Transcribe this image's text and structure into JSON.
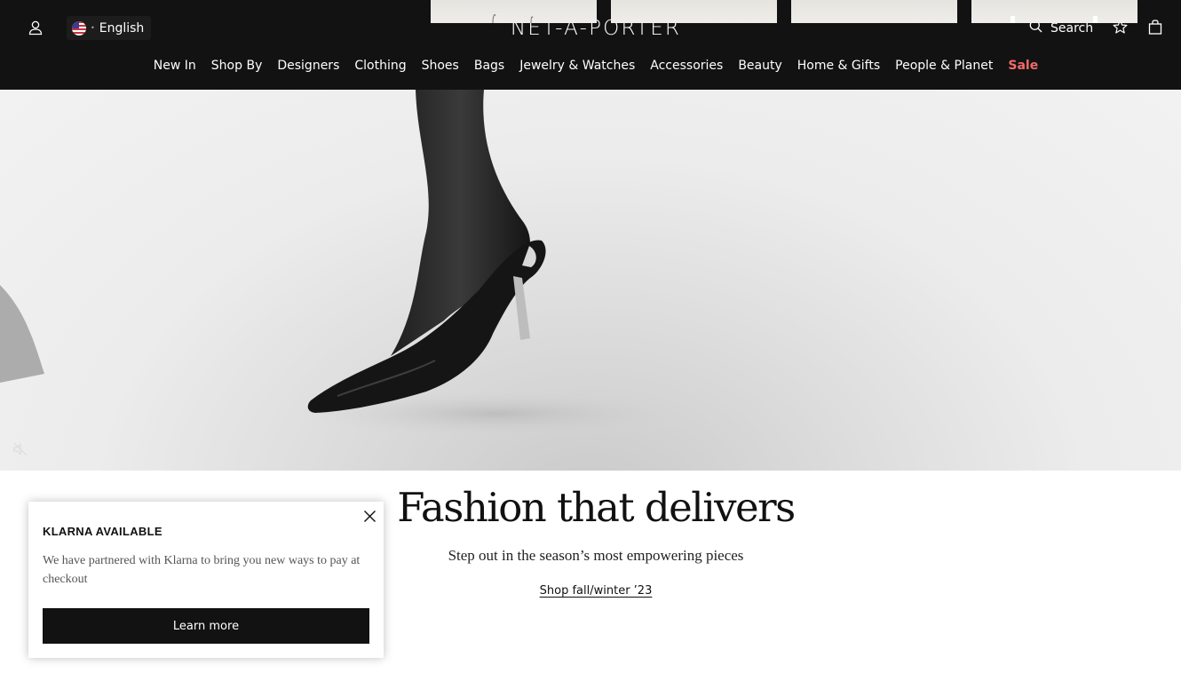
{
  "header": {
    "language_label": "English",
    "logo_text": "NET-A-PORTER",
    "search_label": "Search",
    "icons": [
      "user-icon",
      "us-flag-icon",
      "search-icon",
      "star-icon",
      "shopping-bag-icon"
    ]
  },
  "nav": {
    "items": [
      {
        "label": "New In"
      },
      {
        "label": "Shop By"
      },
      {
        "label": "Designers"
      },
      {
        "label": "Clothing"
      },
      {
        "label": "Shoes"
      },
      {
        "label": "Bags"
      },
      {
        "label": "Jewelry & Watches"
      },
      {
        "label": "Accessories"
      },
      {
        "label": "Beauty"
      },
      {
        "label": "Home & Gifts"
      },
      {
        "label": "People & Planet"
      },
      {
        "label": "Sale"
      }
    ],
    "sale_color": "#f26a6a"
  },
  "hero": {
    "mute_icon": "speaker-muted-icon"
  },
  "promo": {
    "headline": "Fashion that delivers",
    "subline": "Step out in the season’s most empowering pieces",
    "link_label": "Shop fall/winter ’23"
  },
  "klarna_popup": {
    "title": "KLARNA AVAILABLE",
    "body": "We have partnered with Klarna to bring you new ways to pay at checkout",
    "button_label": "Learn more",
    "close_icon": "close-icon"
  },
  "colors": {
    "header_bg": "#121212",
    "accent_sale": "#f26a6a"
  }
}
